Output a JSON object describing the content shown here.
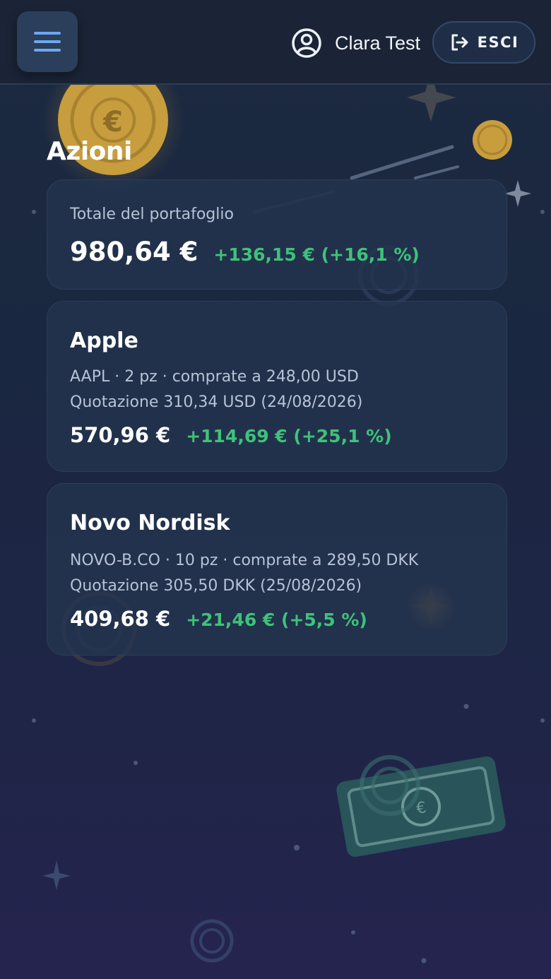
{
  "header": {
    "menu_icon": "hamburger-menu-icon",
    "user_icon": "user-circle-icon",
    "user_name": "Clara Test",
    "logout_icon": "logout-icon",
    "logout_label": "ESCI"
  },
  "page": {
    "title": "Azioni"
  },
  "portfolio": {
    "label": "Totale del portafoglio",
    "total": "980,64 €",
    "change": "+136,15 € (+16,1 %)"
  },
  "stocks": [
    {
      "name": "Apple",
      "details": "AAPL · 2 pz · comprate a 248,00 USD",
      "quote": "Quotazione 310,34 USD (24/08/2026)",
      "value": "570,96 €",
      "change": "+114,69 € (+25,1 %)"
    },
    {
      "name": "Novo Nordisk",
      "details": "NOVO-B.CO · 10 pz · comprate a 289,50 DKK",
      "quote": "Quotazione 305,50 DKK (25/08/2026)",
      "value": "409,68 €",
      "change": "+21,46 € (+5,5 %)"
    }
  ],
  "colors": {
    "accent": "#6ea8f0",
    "positive": "#3ec27a",
    "card": "#24344e",
    "header": "#1a2436"
  }
}
